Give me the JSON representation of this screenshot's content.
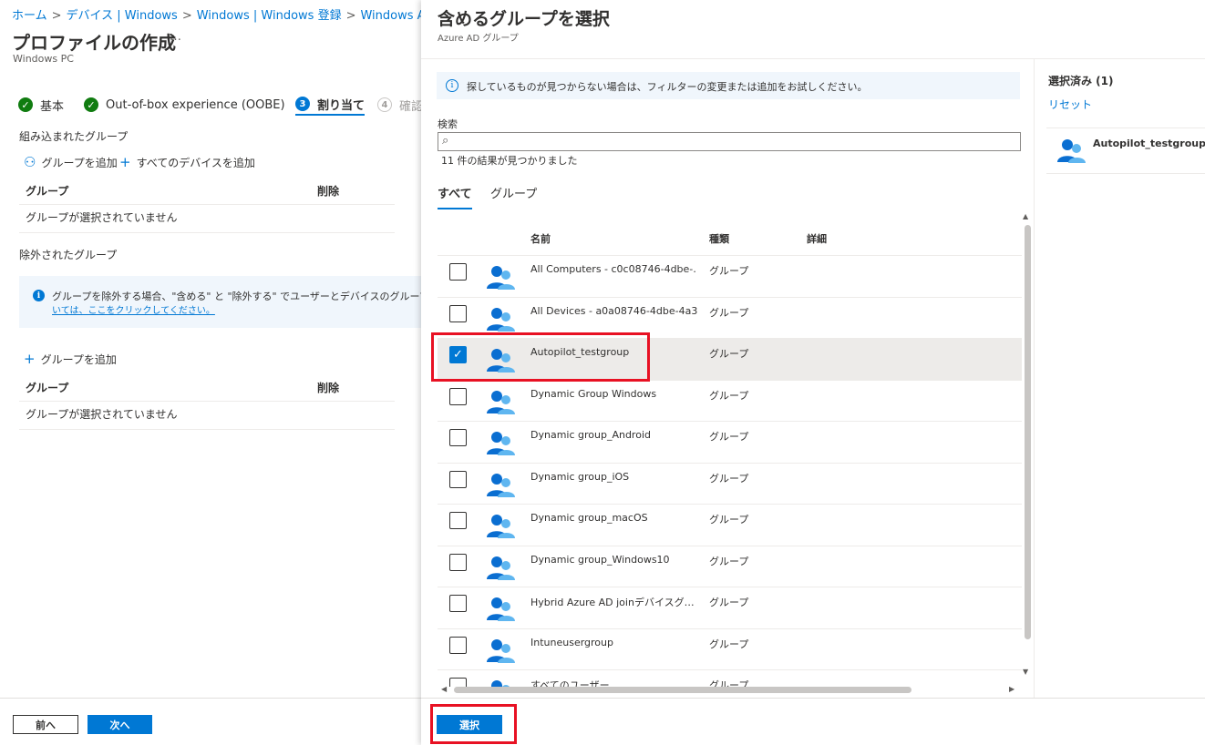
{
  "breadcrumb": [
    {
      "label": "ホーム"
    },
    {
      "label": "デバイス | Windows"
    },
    {
      "label": "Windows | Windows 登録"
    },
    {
      "label": "Windows AutoPi"
    }
  ],
  "page": {
    "title": "プロファイルの作成",
    "more": "…",
    "subtitle": "Windows PC"
  },
  "steps": [
    {
      "label": "基本",
      "state": "done"
    },
    {
      "label": "Out-of-box experience (OOBE)",
      "state": "done"
    },
    {
      "label": "割り当て",
      "number": "3",
      "state": "active"
    },
    {
      "label": "確認",
      "number": "4",
      "state": "pending"
    }
  ],
  "included": {
    "section_label": "組み込まれたグループ",
    "add_group": "グループを追加",
    "add_all_devices": "すべてのデバイスを追加",
    "col_group": "グループ",
    "col_delete": "削除",
    "empty": "グループが選択されていません"
  },
  "excluded": {
    "section_label": "除外されたグループ",
    "info_line1": "グループを除外する場合、\"含める\" と \"除外する\" でユーザーとデバイスのグループを同時に指定す",
    "info_line2": "いては、ここをクリックしてください。",
    "add_group": "グループを追加",
    "col_group": "グループ",
    "col_delete": "削除",
    "empty": "グループが選択されていません"
  },
  "footer": {
    "prev": "前へ",
    "next": "次へ"
  },
  "panel": {
    "title": "含めるグループを選択",
    "subtitle": "Azure AD グループ",
    "info": "探しているものが見つからない場合は、フィルターの変更または追加をお試しください。",
    "search_label": "検索",
    "search_value": "",
    "result_count": "11 件の結果が見つかりました",
    "tabs": [
      {
        "label": "すべて",
        "active": true
      },
      {
        "label": "グループ",
        "active": false
      }
    ],
    "columns": {
      "name": "名前",
      "type": "種類",
      "detail": "詳細"
    },
    "rows": [
      {
        "name": "All Computers - c0c08746-4dbe-…",
        "type": "グループ",
        "checked": false
      },
      {
        "name": "All Devices - a0a08746-4dbe-4a3…",
        "type": "グループ",
        "checked": false
      },
      {
        "name": "Autopilot_testgroup",
        "type": "グループ",
        "checked": true
      },
      {
        "name": "Dynamic Group Windows",
        "type": "グループ",
        "checked": false
      },
      {
        "name": "Dynamic group_Android",
        "type": "グループ",
        "checked": false
      },
      {
        "name": "Dynamic group_iOS",
        "type": "グループ",
        "checked": false
      },
      {
        "name": "Dynamic group_macOS",
        "type": "グループ",
        "checked": false
      },
      {
        "name": "Dynamic group_Windows10",
        "type": "グループ",
        "checked": false
      },
      {
        "name": "Hybrid Azure AD joinデバイスグ…",
        "type": "グループ",
        "checked": false
      },
      {
        "name": "Intuneusergroup",
        "type": "グループ",
        "checked": false
      },
      {
        "name": "すべてのユーザー",
        "type": "グループ",
        "checked": false
      }
    ],
    "select_button": "選択",
    "selected": {
      "title": "選択済み (1)",
      "reset": "リセット",
      "items": [
        {
          "name": "Autopilot_testgroup"
        }
      ]
    }
  },
  "colors": {
    "accent": "#0078d4",
    "success": "#107c10",
    "highlight": "#e81123",
    "selected_row": "#edebe9"
  },
  "icons": {
    "step_done": "checkmark-circle-icon",
    "group": "group-people-icon",
    "info": "info-icon",
    "search": "search-icon",
    "add": "plus-icon",
    "add_user": "add-person-icon"
  }
}
